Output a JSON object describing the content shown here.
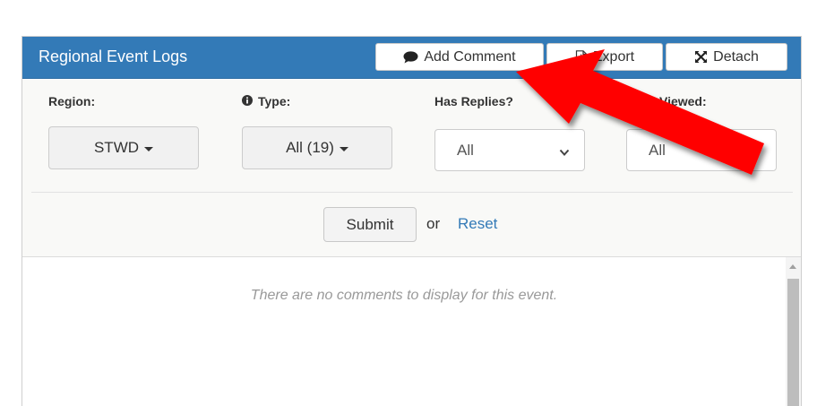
{
  "panel": {
    "title": "Regional Event Logs",
    "accent_color": "#337ab7",
    "buttons": {
      "add_comment": {
        "label": "Add Comment",
        "icon": "comment-icon"
      },
      "export": {
        "label": "Export",
        "icon": "pdf-file-icon"
      },
      "detach": {
        "label": "Detach",
        "icon": "expand-arrows-icon"
      }
    }
  },
  "filters": {
    "region": {
      "label": "Region:",
      "value": "STWD"
    },
    "type": {
      "label": "Type:",
      "value": "All (19)",
      "icon": "info-circle-icon"
    },
    "has_replies": {
      "label": "Has Replies?",
      "value": "All"
    },
    "viewed": {
      "label": "C Viewed:",
      "value": "All"
    },
    "submit_label": "Submit",
    "or_text": "or",
    "reset_label": "Reset"
  },
  "content": {
    "empty_message": "There are no comments to display for this event."
  },
  "annotation": {
    "color": "#ff0000",
    "shape": "arrow pointing at Add Comment button"
  }
}
